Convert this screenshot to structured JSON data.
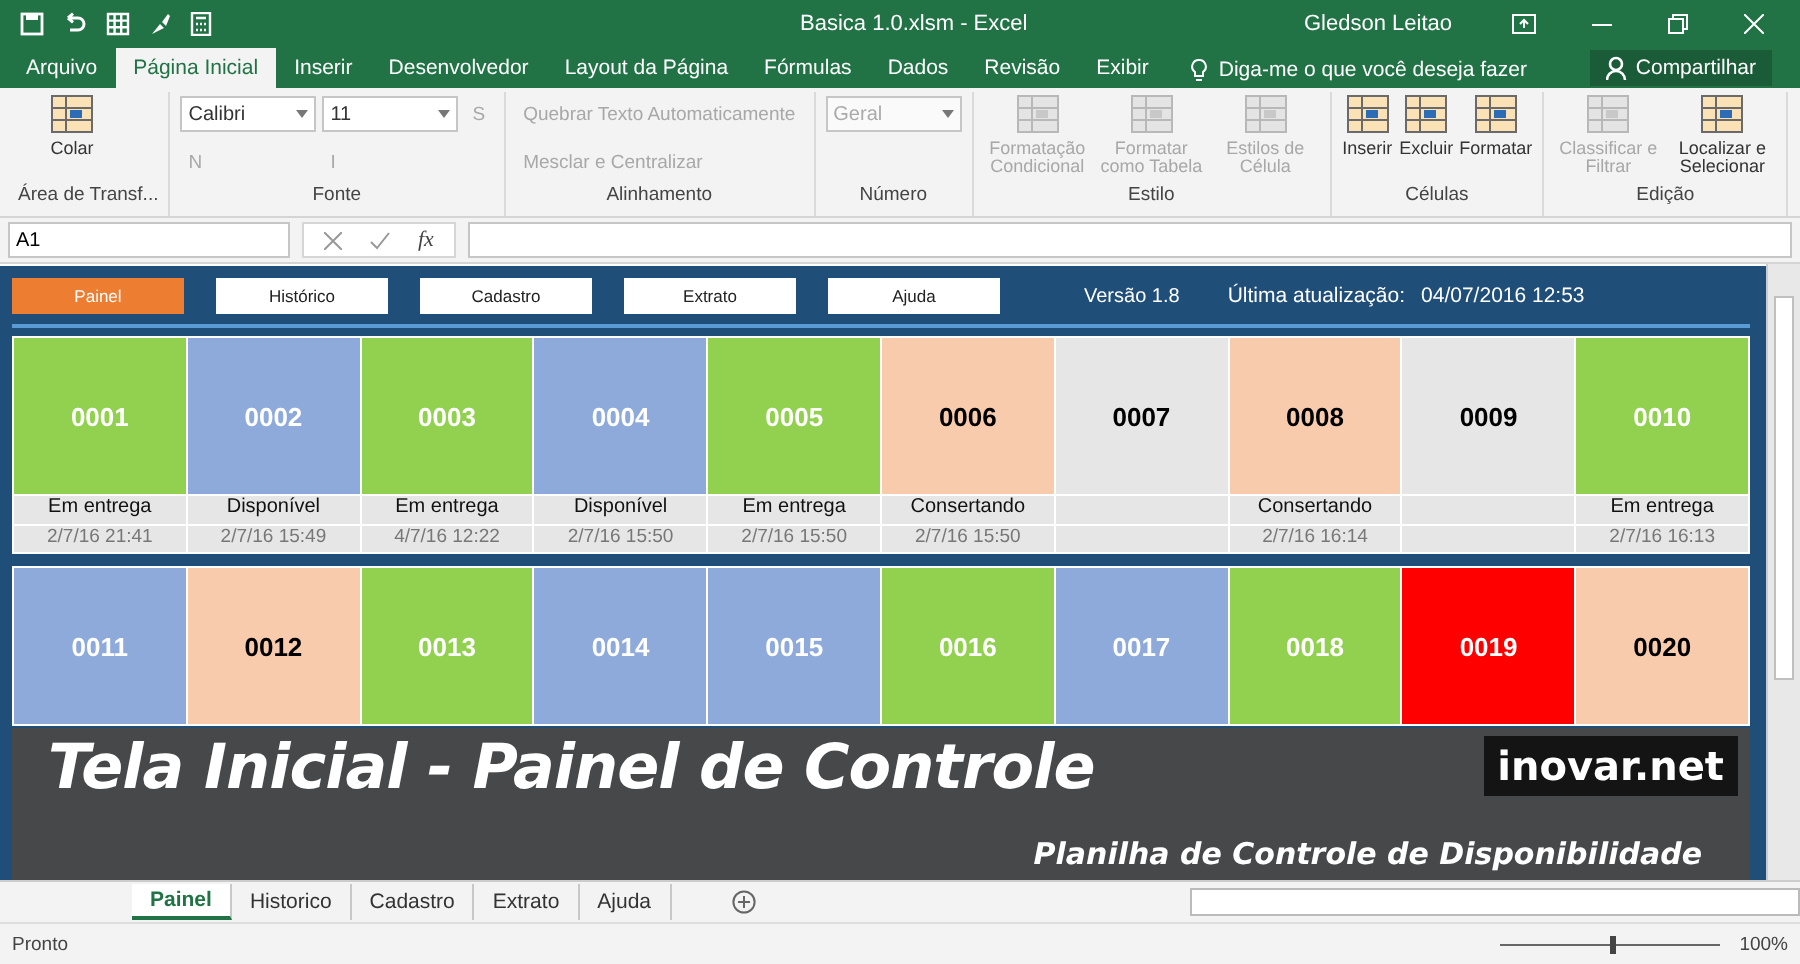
{
  "window": {
    "title": "Basica 1.0.xlsm - Excel",
    "user": "Gledson Leitao"
  },
  "ribbon_tabs": [
    {
      "label": "Arquivo",
      "selected": false
    },
    {
      "label": "Página Inicial",
      "selected": true
    },
    {
      "label": "Inserir",
      "selected": false
    },
    {
      "label": "Desenvolvedor",
      "selected": false
    },
    {
      "label": "Layout da Página",
      "selected": false
    },
    {
      "label": "Fórmulas",
      "selected": false
    },
    {
      "label": "Dados",
      "selected": false
    },
    {
      "label": "Revisão",
      "selected": false
    },
    {
      "label": "Exibir",
      "selected": false
    }
  ],
  "tell_me": "Diga-me o que você deseja fazer",
  "share": "Compartilhar",
  "ribbon_groups": [
    {
      "label": "Área de Transf...",
      "commands": [
        {
          "kind": "large",
          "label": "Colar",
          "disabled": false
        }
      ]
    },
    {
      "label": "Fonte",
      "commands": [
        {
          "kind": "field",
          "label": "Calibri",
          "disabled": false
        },
        {
          "kind": "small",
          "label": "N",
          "disabled": true
        },
        {
          "kind": "field",
          "label": "11",
          "disabled": false
        },
        {
          "kind": "small",
          "label": "I",
          "disabled": true
        },
        {
          "kind": "small",
          "label": "S",
          "disabled": true
        }
      ]
    },
    {
      "label": "Alinhamento",
      "commands": [
        {
          "kind": "small",
          "label": "Quebrar Texto Automaticamente",
          "disabled": true
        },
        {
          "kind": "small",
          "label": "Mesclar e Centralizar",
          "disabled": true
        }
      ]
    },
    {
      "label": "Número",
      "commands": [
        {
          "kind": "field",
          "label": "Geral",
          "disabled": true
        }
      ]
    },
    {
      "label": "Estilo",
      "commands": [
        {
          "kind": "large",
          "label": "Formatação Condicional",
          "disabled": true
        },
        {
          "kind": "large",
          "label": "Formatar como Tabela",
          "disabled": true
        },
        {
          "kind": "large",
          "label": "Estilos de Célula",
          "disabled": true
        }
      ]
    },
    {
      "label": "Células",
      "commands": [
        {
          "kind": "large",
          "label": "Inserir",
          "disabled": false
        },
        {
          "kind": "large",
          "label": "Excluir",
          "disabled": false
        },
        {
          "kind": "large",
          "label": "Formatar",
          "disabled": false
        }
      ]
    },
    {
      "label": "Edição",
      "commands": [
        {
          "kind": "large",
          "label": "Classificar e Filtrar",
          "disabled": true
        },
        {
          "kind": "large",
          "label": "Localizar e Selecionar",
          "disabled": false
        }
      ]
    }
  ],
  "formula_bar": {
    "name_box": "A1",
    "function_label": "fx"
  },
  "nav_buttons": [
    {
      "label": "Painel",
      "selected": true
    },
    {
      "label": "Histórico",
      "selected": false
    },
    {
      "label": "Cadastro",
      "selected": false
    },
    {
      "label": "Extrato",
      "selected": false
    },
    {
      "label": "Ajuda",
      "selected": false
    }
  ],
  "version": "Versão 1.8",
  "last_update_label": "Última atualização:",
  "last_update": "04/07/2016 12:53",
  "card_rows": [
    [
      {
        "code": "0001",
        "color": "#92d050",
        "status": "Em entrega",
        "date": "2/7/16 21:41"
      },
      {
        "code": "0002",
        "color": "#8eaadb",
        "status": "Disponível",
        "date": "2/7/16 15:49"
      },
      {
        "code": "0003",
        "color": "#92d050",
        "status": "Em entrega",
        "date": "4/7/16 12:22"
      },
      {
        "code": "0004",
        "color": "#8eaadb",
        "status": "Disponível",
        "date": "2/7/16 15:50"
      },
      {
        "code": "0005",
        "color": "#92d050",
        "status": "Em entrega",
        "date": "2/7/16 15:50"
      },
      {
        "code": "0006",
        "color": "#f8cbad",
        "status": "Consertando",
        "date": "2/7/16 15:50"
      },
      {
        "code": "0007",
        "color": "#e7e6e6"
      },
      {
        "code": "0008",
        "color": "#f8cbad",
        "status": "Consertando",
        "date": "2/7/16 16:14"
      },
      {
        "code": "0009",
        "color": "#e7e6e6"
      },
      {
        "code": "0010",
        "color": "#92d050",
        "status": "Em entrega",
        "date": "2/7/16 16:13"
      }
    ],
    [
      {
        "code": "0011",
        "color": "#8eaadb"
      },
      {
        "code": "0012",
        "color": "#f8cbad"
      },
      {
        "code": "0013",
        "color": "#92d050"
      },
      {
        "code": "0014",
        "color": "#8eaadb"
      },
      {
        "code": "0015",
        "color": "#8eaadb"
      },
      {
        "code": "0016",
        "color": "#92d050"
      },
      {
        "code": "0017",
        "color": "#8eaadb"
      },
      {
        "code": "0018",
        "color": "#92d050"
      },
      {
        "code": "0019",
        "color": "#ff0000"
      },
      {
        "code": "0020",
        "color": "#f8cbad"
      }
    ]
  ],
  "banner": {
    "title": "Tela Inicial - Painel de Controle",
    "site": "inovar.net",
    "subtitle": "Planilha de Controle de Disponibilidade"
  },
  "sheet_tabs": [
    {
      "label": "Painel",
      "selected": true
    },
    {
      "label": "Historico",
      "selected": false
    },
    {
      "label": "Cadastro",
      "selected": false
    },
    {
      "label": "Extrato",
      "selected": false
    },
    {
      "label": "Ajuda",
      "selected": false
    }
  ],
  "status_bar": {
    "state": "Pronto",
    "zoom": "100%",
    "zoom_slider": {
      "level": 0.5
    }
  }
}
